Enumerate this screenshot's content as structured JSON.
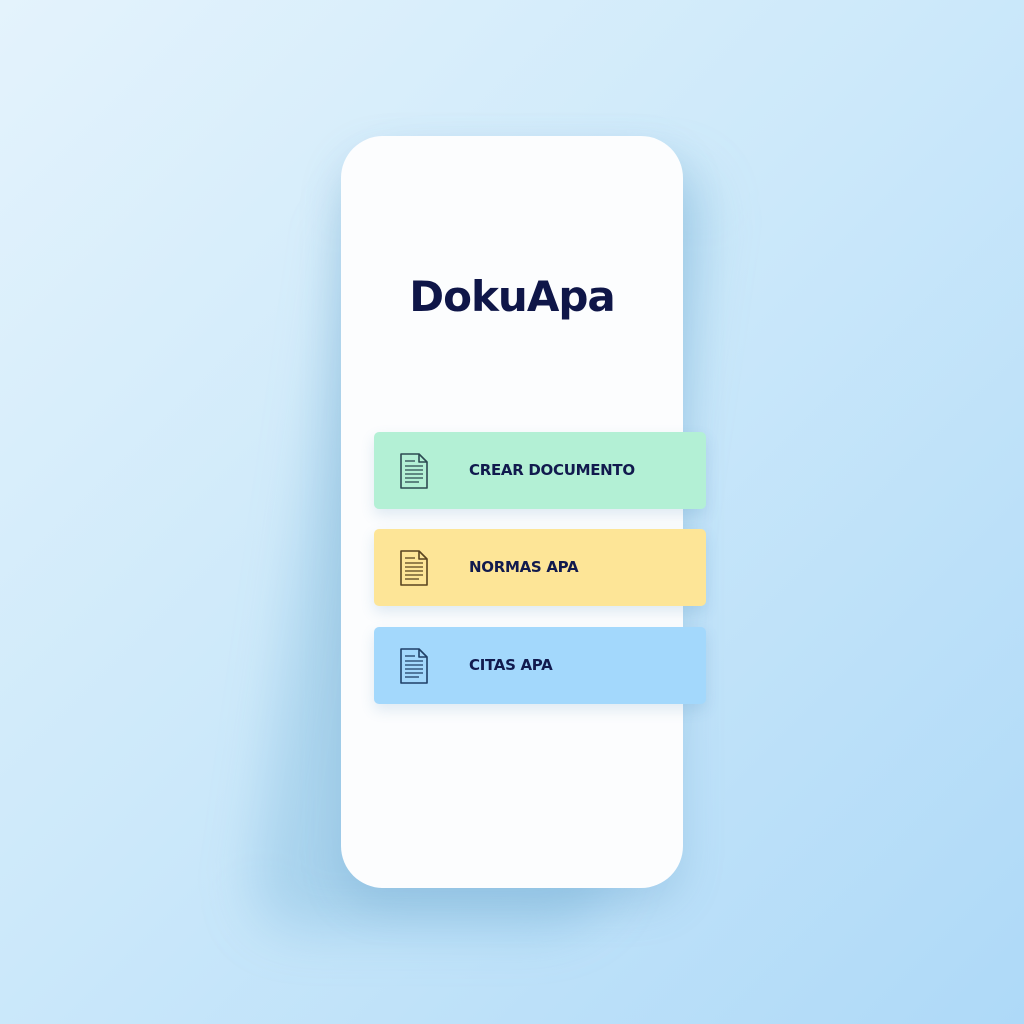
{
  "app": {
    "title": "DokuApa"
  },
  "menu": {
    "items": [
      {
        "label": "CREAR DOCUMENTO",
        "icon": "document-icon",
        "color": "#b3f0d5"
      },
      {
        "label": "NORMAS APA",
        "icon": "document-icon",
        "color": "#fde597"
      },
      {
        "label": "CITAS APA",
        "icon": "document-icon",
        "color": "#a3d8fc"
      }
    ]
  }
}
